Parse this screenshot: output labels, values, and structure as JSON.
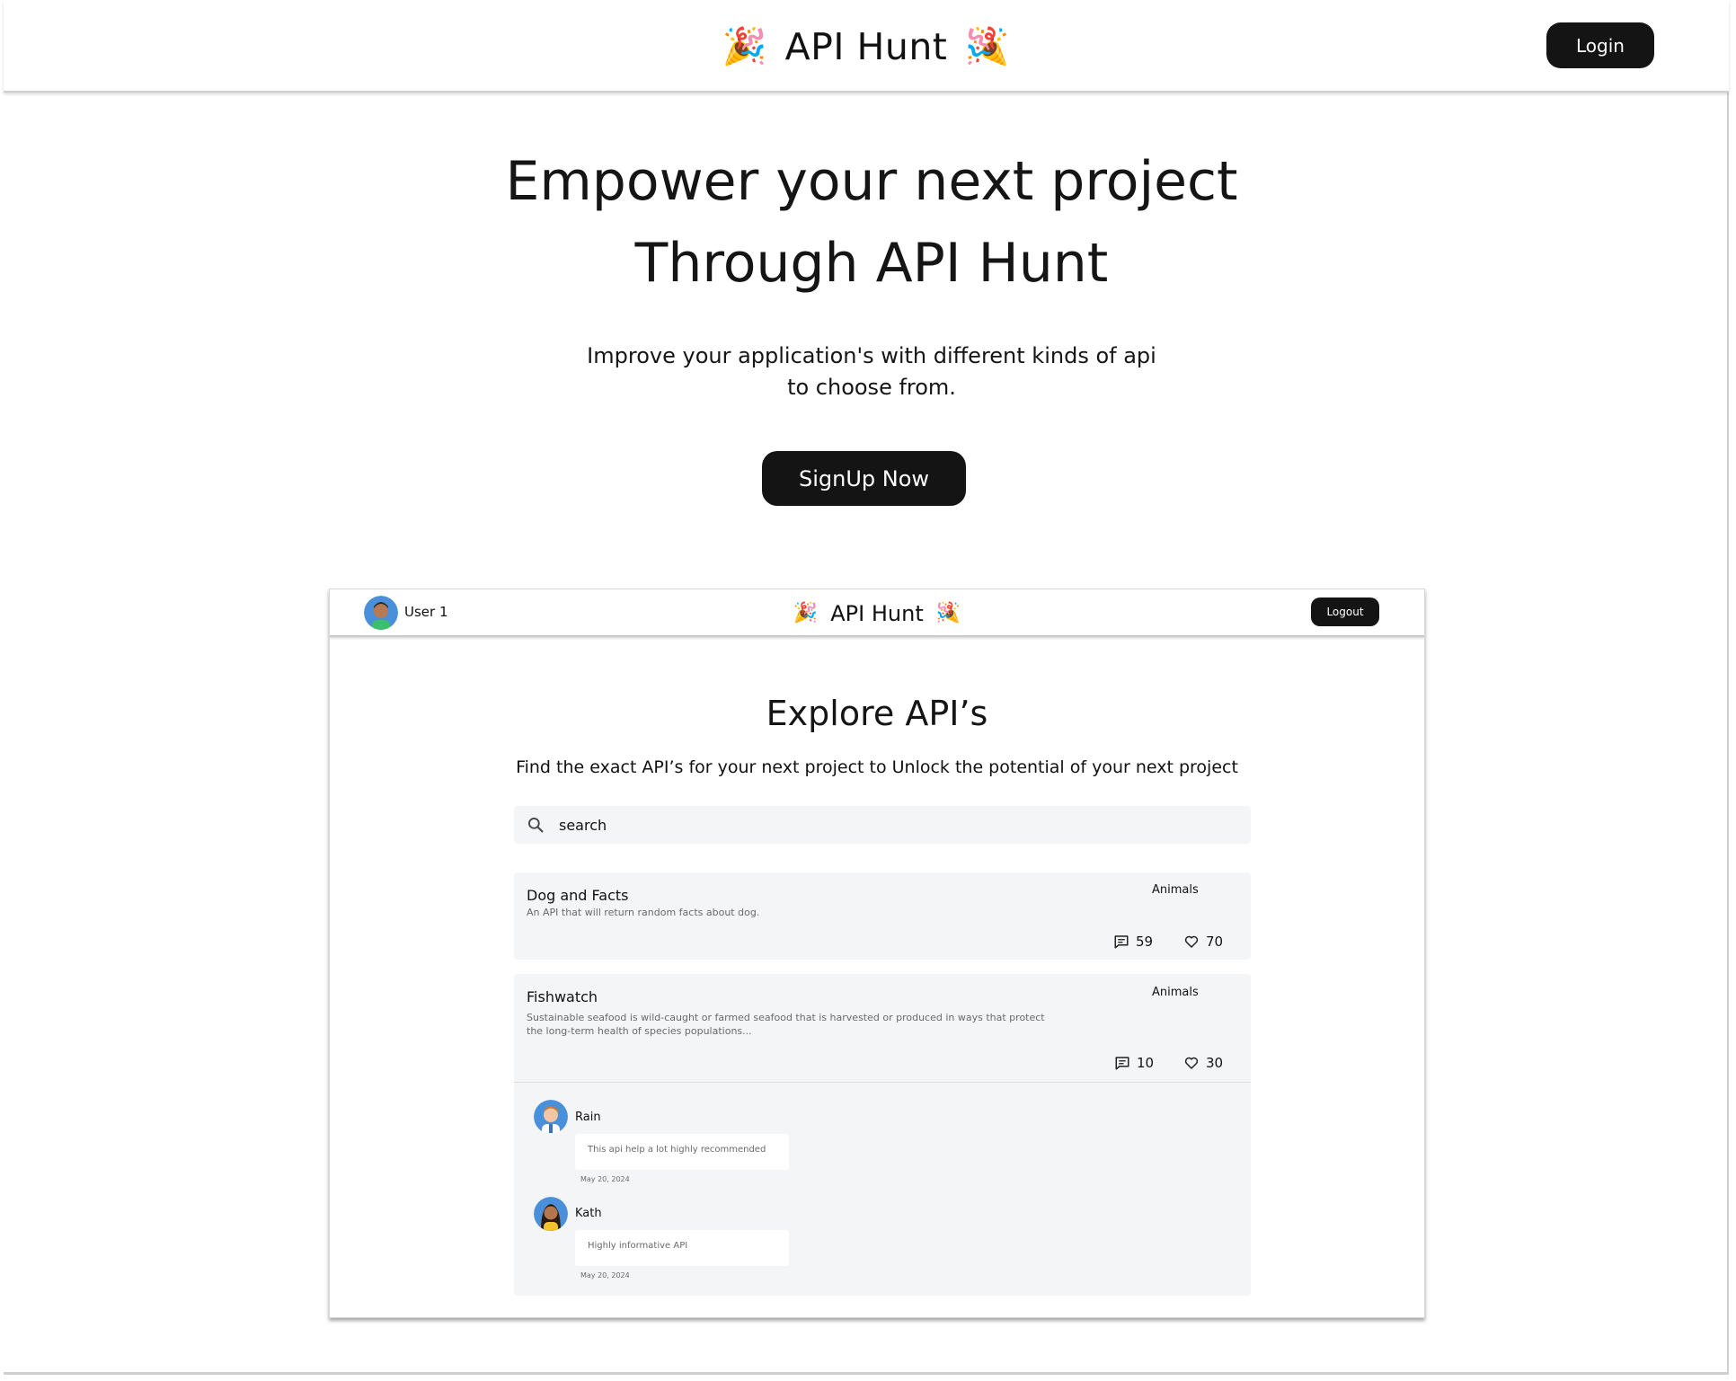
{
  "header": {
    "app_title": "API Hunt",
    "login_label": "Login"
  },
  "hero": {
    "title_line1": "Empower your next project",
    "title_line2": "Through API Hunt",
    "subtitle_line1": "Improve your application's with different kinds of api",
    "subtitle_line2": "to choose from.",
    "signup_label": "SignUp Now"
  },
  "preview": {
    "user_name": "User 1",
    "app_title": "API Hunt",
    "logout_label": "Logout",
    "page_title": "Explore API’s",
    "page_description": "Find the exact API’s for your next project to Unlock the potential of your next project",
    "search": {
      "value": "search",
      "placeholder": "search"
    },
    "apis": [
      {
        "name": "Dog and Facts",
        "description": "An API that will return random facts about dog.",
        "category": "Animals",
        "comments": "59",
        "likes": "70"
      },
      {
        "name": "Fishwatch",
        "description": "Sustainable seafood is wild-caught or farmed seafood that is harvested or produced in ways that protect the long-term health of species populations...",
        "category": "Animals",
        "comments": "10",
        "likes": "30",
        "comment_list": [
          {
            "author": "Rain",
            "text": "This api help a lot highly recommended",
            "date": "May 20, 2024"
          },
          {
            "author": "Kath",
            "text": "Highly informative API",
            "date": "May 20, 2024"
          }
        ]
      }
    ]
  },
  "colors": {
    "primary_button": "#141414",
    "card_background": "#f4f5f6",
    "text": "#111111",
    "muted_text": "#6a6a6a"
  },
  "icons": [
    "party-popper-icon",
    "search-icon",
    "comment-icon",
    "heart-icon"
  ]
}
